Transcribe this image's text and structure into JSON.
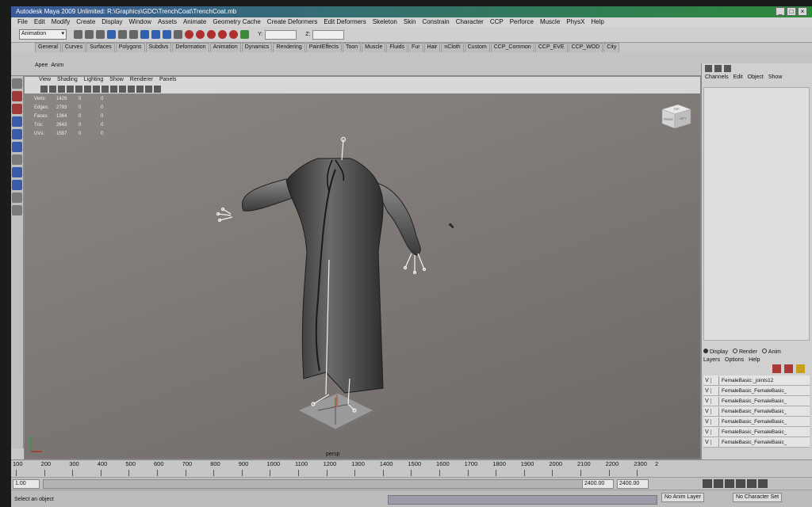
{
  "window": {
    "title": "Autodesk Maya 2009 Unlimited: R:\\Graphics\\GDC\\TrenchCoat\\TrenchCoat.mb"
  },
  "menubar": [
    "File",
    "Edit",
    "Modify",
    "Create",
    "Display",
    "Window",
    "Assets",
    "Animate",
    "Geometry Cache",
    "Create Deformers",
    "Edit Deformers",
    "Skeleton",
    "Skin",
    "Constrain",
    "Character",
    "CCP",
    "Perforce",
    "Muscle",
    "PhysX",
    "Help"
  ],
  "status_line": {
    "mode": "Animation",
    "y_label": "Y:",
    "z_label": "Z:"
  },
  "shelf_tabs": [
    "General",
    "Curves",
    "Surfaces",
    "Polygons",
    "Subdivs",
    "Deformation",
    "Animation",
    "Dynamics",
    "Rendering",
    "PaintEffects",
    "Toon",
    "Muscle",
    "Fluids",
    "Fur",
    "Hair",
    "nCloth",
    "Custom",
    "CCP_Common",
    "CCP_EVE",
    "CCP_WOD",
    "City"
  ],
  "shelf_labels": [
    "Apee",
    "Anim"
  ],
  "panel_menu": [
    "View",
    "Shading",
    "Lighting",
    "Show",
    "Renderer",
    "Panels"
  ],
  "hud": [
    {
      "label": "Verts:",
      "v1": "1429",
      "v2": "0",
      "v3": "0"
    },
    {
      "label": "Edges:",
      "v1": "2793",
      "v2": "0",
      "v3": "0"
    },
    {
      "label": "Faces:",
      "v1": "1364",
      "v2": "0",
      "v3": "0"
    },
    {
      "label": "Tris:",
      "v1": "2643",
      "v2": "0",
      "v3": "0"
    },
    {
      "label": "UVs:",
      "v1": "1587",
      "v2": "0",
      "v3": "0"
    }
  ],
  "viewcube": {
    "top": "TOP",
    "front": "FRONT",
    "left": "LEFT"
  },
  "camera_label": "persp",
  "channel_box": {
    "menu": [
      "Channels",
      "Edit",
      "Object",
      "Show"
    ]
  },
  "layer_editor": {
    "radios": [
      {
        "label": "Display",
        "selected": true
      },
      {
        "label": "Render",
        "selected": false
      },
      {
        "label": "Anim",
        "selected": false
      }
    ],
    "menu": [
      "Layers",
      "Options",
      "Help"
    ],
    "layers": [
      {
        "vis": "V",
        "name": "FemaleBasic:_joints12"
      },
      {
        "vis": "V",
        "name": "FemaleBasic_FemaleBasic_"
      },
      {
        "vis": "V",
        "name": "FemaleBasic_FemaleBasic_"
      },
      {
        "vis": "V",
        "name": "FemaleBasic_FemaleBasic_"
      },
      {
        "vis": "V",
        "name": "FemaleBasic_FemaleBasic_"
      },
      {
        "vis": "V",
        "name": "FemaleBasic_FemaleBasic_"
      },
      {
        "vis": "V",
        "name": "FemaleBasic_FemaleBasic_"
      }
    ]
  },
  "timeline": {
    "ticks": [
      "100",
      "200",
      "300",
      "400",
      "500",
      "600",
      "700",
      "800",
      "900",
      "1000",
      "1100",
      "1200",
      "1300",
      "1400",
      "1500",
      "1600",
      "1700",
      "1800",
      "1900",
      "2000",
      "2100",
      "2200",
      "2300"
    ],
    "current_frame": "2"
  },
  "range": {
    "start": "1.00",
    "end1": "2400.00",
    "end2": "2400.00",
    "anim_layer": "No Anim Layer",
    "character": "No Character Set"
  },
  "help_line": "Select an object"
}
